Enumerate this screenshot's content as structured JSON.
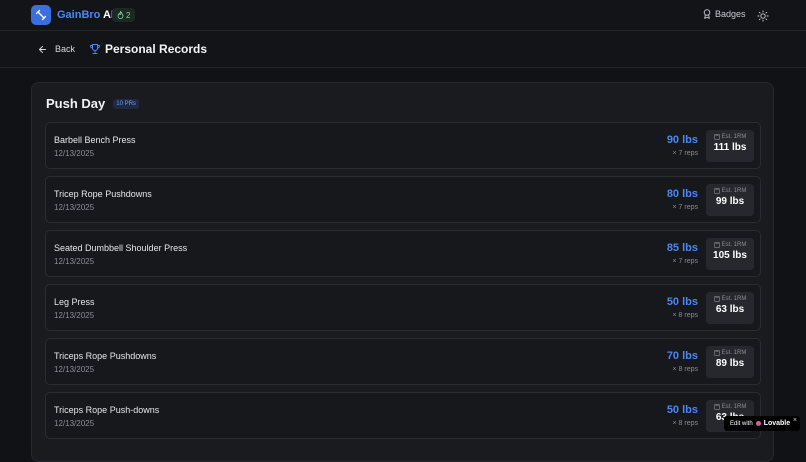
{
  "header": {
    "brand_part1": "GainBro",
    "brand_part2": " AI",
    "streak_count": "2",
    "badges_label": "Badges"
  },
  "subheader": {
    "back_label": "Back",
    "title": "Personal Records"
  },
  "section": {
    "title": "Push Day",
    "pr_badge": "10 PRs",
    "est_label": "Est. 1RM",
    "records": [
      {
        "name": "Barbell Bench Press",
        "date": "12/13/2025",
        "weight": "90 lbs",
        "reps": "× 7 reps",
        "one_rm": "111 lbs"
      },
      {
        "name": "Tricep Rope Pushdowns",
        "date": "12/13/2025",
        "weight": "80 lbs",
        "reps": "× 7 reps",
        "one_rm": "99 lbs"
      },
      {
        "name": "Seated Dumbbell Shoulder Press",
        "date": "12/13/2025",
        "weight": "85 lbs",
        "reps": "× 7 reps",
        "one_rm": "105 lbs"
      },
      {
        "name": "Leg Press",
        "date": "12/13/2025",
        "weight": "50 lbs",
        "reps": "× 8 reps",
        "one_rm": "63 lbs"
      },
      {
        "name": "Triceps Rope Pushdowns",
        "date": "12/13/2025",
        "weight": "70 lbs",
        "reps": "× 8 reps",
        "one_rm": "89 lbs"
      },
      {
        "name": "Triceps Rope Push-downs",
        "date": "12/13/2025",
        "weight": "50 lbs",
        "reps": "× 8 reps",
        "one_rm": "63 lbs"
      }
    ]
  },
  "lovable_badge": {
    "prefix": "Edit with",
    "brand": "Lovable",
    "close": "×"
  },
  "colors": {
    "accent": "#4a86f5",
    "background": "#111215",
    "card": "#1a1b1f"
  }
}
